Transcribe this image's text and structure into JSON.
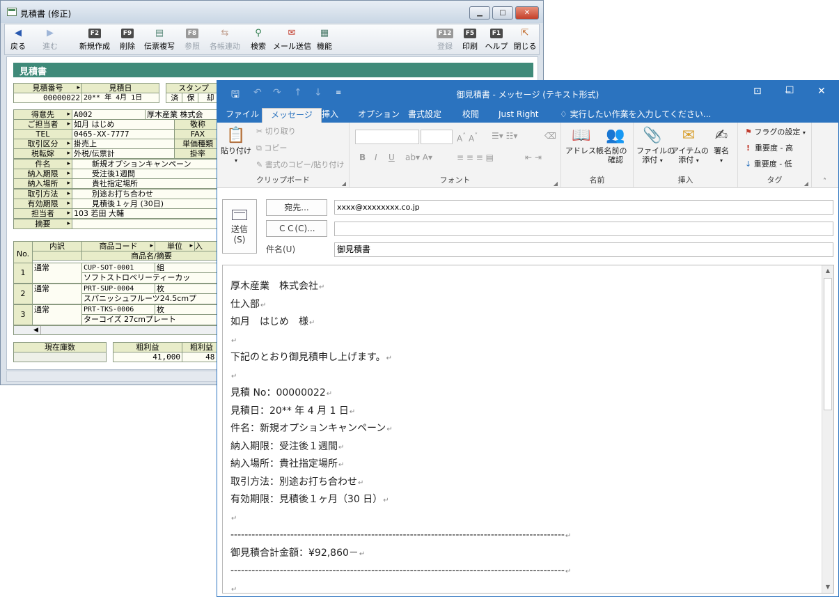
{
  "estimate_window": {
    "title": "見積書 (修正)",
    "toolbar": [
      {
        "key": "",
        "label": "戻る",
        "icon": "back-arrow-icon",
        "enabled": true
      },
      {
        "key": "",
        "label": "進む",
        "icon": "forward-arrow-icon",
        "enabled": false
      },
      {
        "key": "F2",
        "label": "新規作成",
        "enabled": true
      },
      {
        "key": "F9",
        "label": "削除",
        "enabled": true
      },
      {
        "key": "",
        "label": "伝票複写",
        "icon": "copy-slip-icon",
        "enabled": true
      },
      {
        "key": "F8",
        "label": "参照",
        "enabled": false
      },
      {
        "key": "",
        "label": "各帳連动",
        "icon": "link-icon",
        "enabled": false
      },
      {
        "key": "",
        "label": "検索",
        "icon": "search-icon",
        "enabled": true
      },
      {
        "key": "",
        "label": "メール送信",
        "icon": "mail-send-icon",
        "enabled": true
      },
      {
        "key": "",
        "label": "機能",
        "icon": "function-icon",
        "enabled": true
      },
      {
        "key": "F12",
        "label": "登録",
        "enabled": false
      },
      {
        "key": "F5",
        "label": "印刷",
        "enabled": true
      },
      {
        "key": "F1",
        "label": "ヘルプ",
        "enabled": true
      },
      {
        "key": "",
        "label": "閉じる",
        "icon": "close-door-icon",
        "enabled": true
      }
    ],
    "header": "見積書",
    "estimate_no_label": "見積番号",
    "estimate_no": "00000022",
    "estimate_date_label": "見積日",
    "estimate_date": "20** 年  4月  1日",
    "stamp_label": "スタンプ",
    "stamps": [
      "済",
      "保",
      "却"
    ],
    "customer_label": "得意先",
    "customer_code": "A002",
    "customer_name": "厚木産業  株式会",
    "contact_label": "ご担当者",
    "contact": "如月  はじめ",
    "honorific_label": "敬称",
    "tel_label": "TEL",
    "tel": "0465-XX-7777",
    "fax_label": "FAX",
    "txn_label": "取引区分",
    "txn": "掛売上",
    "price_type_label": "単価種類",
    "tax_label": "税転嫁",
    "tax": "外税/伝票計",
    "rate_label": "掛率",
    "subject_label": "件名",
    "subject": "新規オプションキャンペーン",
    "deadline_label": "納入期限",
    "deadline": "受注後1週間",
    "place_label": "納入場所",
    "place": "貴社指定場所",
    "method_label": "取引方法",
    "method": "別途お打ち合わせ",
    "validity_label": "有効期限",
    "validity": "見積後１ヶ月 (30日)",
    "staff_label": "担当者",
    "staff": "103 若田 大輔",
    "memo_label": "摘要",
    "table_headers": {
      "no": "No.",
      "kind": "内訳",
      "code": "商品コード",
      "name": "商品名/摘要",
      "unit": "単位",
      "qty": "入"
    },
    "rows": [
      {
        "no": "1",
        "kind": "通常",
        "code": "CUP-SOT-0001",
        "unit": "組",
        "name": "ソフトストロベリーティーカッ"
      },
      {
        "no": "2",
        "kind": "通常",
        "code": "PRT-SUP-0004",
        "unit": "枚",
        "name": "スパニッシュフルーツ24.5cmプ"
      },
      {
        "no": "3",
        "kind": "通常",
        "code": "PRT-TKS-0006",
        "unit": "枚",
        "name": "ターコイズ 27cmプレート"
      }
    ],
    "stock_label": "現在庫数",
    "profit_label": "粗利益",
    "profit": "41,000",
    "profit2_label": "粗利益",
    "profit2": "48."
  },
  "mail_window": {
    "title": "御見積書 - メッセージ (テキスト形式)",
    "tabs": [
      "ファイル",
      "メッセージ",
      "挿入",
      "オプション",
      "書式設定",
      "校閲",
      "Just Right"
    ],
    "tell_me": "実行したい作業を入力してください...",
    "clipboard": {
      "paste": "貼り付け",
      "cut": "切り取り",
      "copy": "コピー",
      "format_painter": "書式のコピー/貼り付け",
      "group": "クリップボード"
    },
    "font_group": "フォント",
    "names": {
      "address_book": "アドレス帳",
      "check_names_1": "名前の",
      "check_names_2": "確認",
      "group": "名前"
    },
    "insert": {
      "attach_file_1": "ファイルの",
      "attach_file_2": "添付",
      "attach_item_1": "アイテムの",
      "attach_item_2": "添付",
      "signature": "署名",
      "group": "挿入"
    },
    "tags": {
      "flag": "フラグの設定",
      "high": "重要度 - 高",
      "low": "重要度 - 低",
      "group": "タグ"
    },
    "send_label_1": "送信",
    "send_label_2": "(S)",
    "to_button": "宛先...",
    "to_value": "xxxx@xxxxxxxx.co.jp",
    "cc_button": "ＣＣ(C)...",
    "cc_value": "",
    "subject_label": "件名(U)",
    "subject_value": "御見積書",
    "body_lines": [
      "厚木産業　株式会社",
      "仕入部",
      "如月　はじめ　様",
      "",
      "下記のとおり御見積申し上げます。",
      "",
      "見積 No：00000022",
      "見積日：20** 年  4 月  1 日",
      "件名：新規オプションキャンペーン",
      "納入期限：受注後１週間",
      "納入場所：貴社指定場所",
      "取引方法：別途お打ち合わせ",
      "有効期限：見積後１ヶ月（30 日）",
      "",
      "-----------------------------------------------------------------------------------------------",
      "御見積合計金額：¥92,860－",
      "-----------------------------------------------------------------------------------------------",
      ""
    ]
  }
}
